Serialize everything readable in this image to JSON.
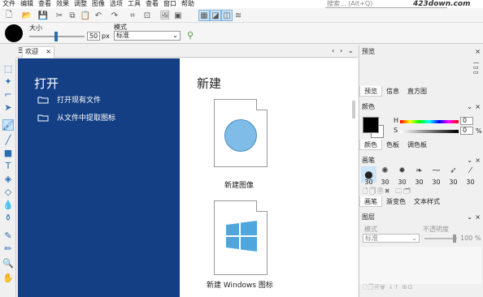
{
  "menu": [
    "文件",
    "编辑",
    "查看",
    "效果",
    "调整",
    "图像",
    "选项",
    "工具",
    "查看",
    "窗口",
    "帮助"
  ],
  "search": {
    "placeholder": "搜索... (Alt+Q)"
  },
  "watermark": "423down.com",
  "options": {
    "size_label": "大小",
    "size_value": "50",
    "size_unit": "px",
    "mode_label": "模式",
    "mode_value": "标准"
  },
  "tabs": [
    {
      "label": "欢迎",
      "close": "×"
    }
  ],
  "welcome": {
    "open_title": "打开",
    "open_existing": "打开现有文件",
    "extract_icon": "从文件中提取图标",
    "new_title": "新建",
    "new_image": "新建图像",
    "new_windows_icon": "新建 Windows 图标"
  },
  "panels": {
    "preview": {
      "title": "预览",
      "tabs": [
        "预览",
        "信息",
        "直方图"
      ]
    },
    "color": {
      "title": "颜色",
      "h_label": "H",
      "h_value": "0",
      "s_label": "S",
      "s_value": "0",
      "pct": "%",
      "tabs": [
        "颜色",
        "色板",
        "调色板"
      ],
      "primary": "#000000",
      "secondary": "#ffffff"
    },
    "brush": {
      "title": "画笔",
      "sizes": [
        "30",
        "30",
        "30",
        "30",
        "30",
        "30",
        "30"
      ],
      "tabs": [
        "画笔",
        "渐变色",
        "文本样式"
      ]
    },
    "layers": {
      "title": "图层",
      "mode_label": "模式",
      "opacity_label": "不透明度",
      "mode_value": "标准",
      "opacity_value": "100",
      "opacity_unit": "%"
    }
  },
  "colors": {
    "accent": "#143f85",
    "icon_blue": "#7fbde8",
    "win_blue": "#4ea6dc"
  }
}
